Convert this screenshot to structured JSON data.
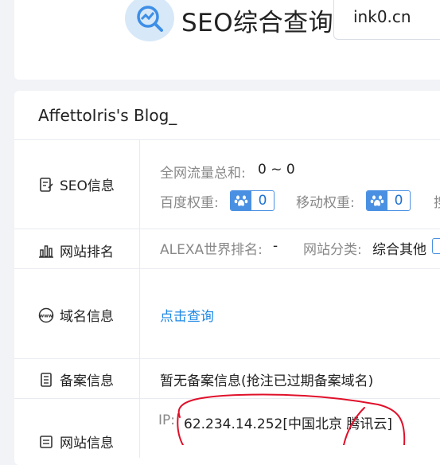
{
  "header": {
    "title": "SEO综合查询",
    "search_value": "ink0.cn"
  },
  "site": {
    "blog_title": "AffettoIris's Blog_"
  },
  "rows": {
    "seo": {
      "label": "SEO信息",
      "traffic_label": "全网流量总和:",
      "traffic_value": "0 ~ 0",
      "baidu_label": "百度权重:",
      "baidu_value": "0",
      "mobile_label": "移动权重:",
      "mobile_value": "0",
      "cut_char": "搜"
    },
    "rank": {
      "label": "网站排名",
      "alexa_label": "ALEXA世界排名:",
      "alexa_value": "-",
      "category_label": "网站分类:",
      "category_value": "综合其他"
    },
    "domain": {
      "label": "域名信息",
      "link": "点击查询"
    },
    "icp": {
      "label": "备案信息",
      "value": "暂无备案信息(抢注已过期备案域名)"
    },
    "network": {
      "label": "网站信息",
      "ip_label": "IP:",
      "ip_value": "62.234.14.252[中国北京 腾讯云]"
    }
  },
  "colors": {
    "accent": "#1e88e5",
    "badge": "#4a90e2",
    "annotation": "#e0102a"
  }
}
